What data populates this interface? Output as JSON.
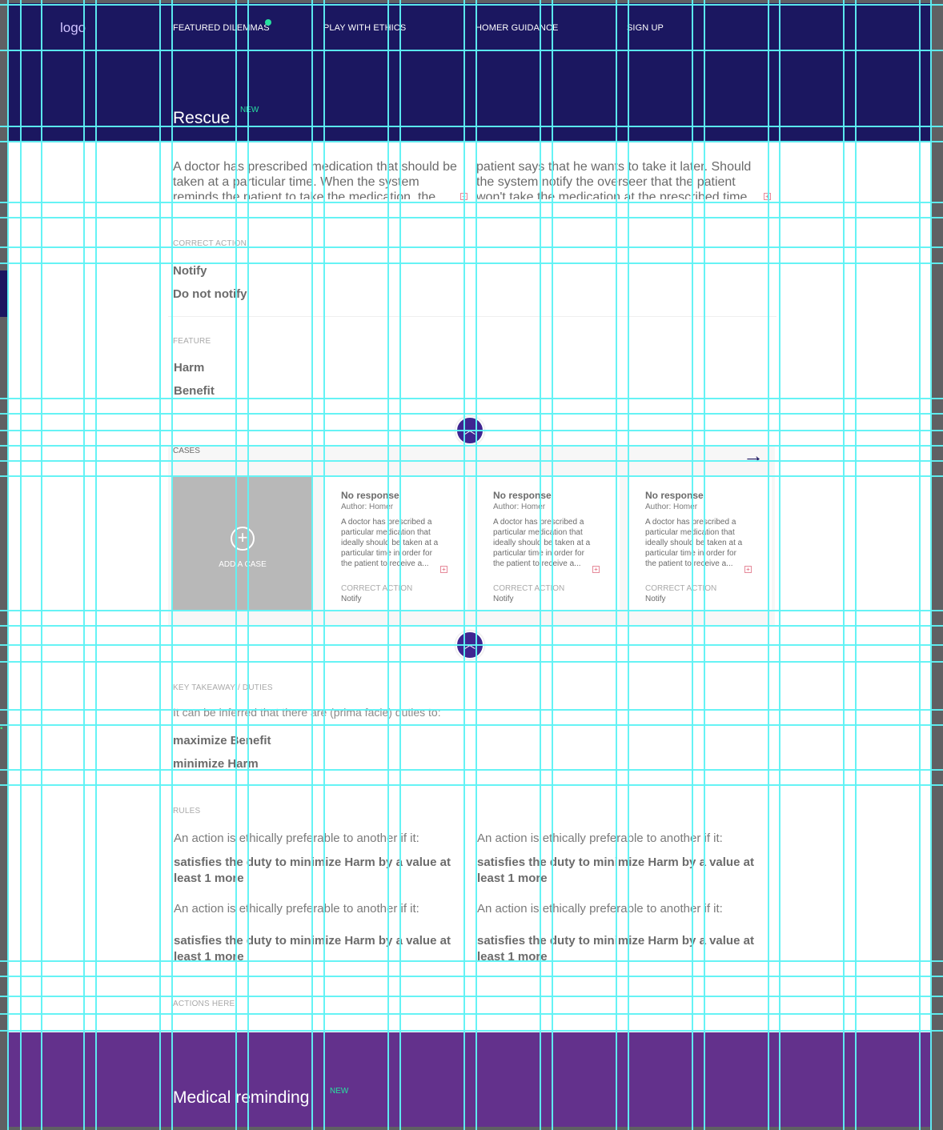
{
  "header": {
    "logo": "logo",
    "nav": [
      "FEATURED DILEMMAS",
      "PLAY WITH ETHICS",
      "HOMER GUIDANCE",
      "SIGN UP"
    ],
    "title": "Rescue",
    "badge": "NEW"
  },
  "description": {
    "col1": "A doctor has prescribed medication that should be taken at a particular time. When the system reminds the patient to take the medication, the",
    "col2": "patient says that he wants to take it later. Should the system notify the overseer that the patient won't take the medication at the prescribed time."
  },
  "correct_action": {
    "label": "CORRECT ACTION",
    "options": [
      "Notify",
      "Do not notify"
    ]
  },
  "feature": {
    "label": "FEATURE",
    "options": [
      "Harm",
      "Benefit"
    ]
  },
  "cases": {
    "label": "CASES",
    "add_label": "ADD A CASE",
    "items": [
      {
        "title": "No response",
        "author": "Author: Homer",
        "description": "A doctor has prescribed a particular medication that ideally should be taken at a particular time in order for the patient to receive a...",
        "ca_label": "CORRECT ACTION",
        "ca_value": "Notify"
      },
      {
        "title": "No response",
        "author": "Author: Homer",
        "description": "A doctor has prescribed a particular medication that ideally should be taken at a particular time in order for the patient to receive a...",
        "ca_label": "CORRECT ACTION",
        "ca_value": "Notify"
      },
      {
        "title": "No response",
        "author": "Author: Homer",
        "description": "A doctor has prescribed a particular medication that ideally should be taken at a particular time in order for the patient to receive a...",
        "ca_label": "CORRECT ACTION",
        "ca_value": "Notify"
      }
    ]
  },
  "takeaway": {
    "label": "KEY TAKEAWAY / DUTIES",
    "text": "It can be inferred that there are (prima facie) duties to:",
    "duties": [
      "maximize Benefit",
      "minimize Harm"
    ]
  },
  "rules": {
    "label": "RULES",
    "items": [
      {
        "intro": "An action is ethically preferable to another if it:",
        "text": "satisfies the duty to minimize Harm by a value at least 1 more"
      },
      {
        "intro": "An action is ethically preferable to another if it:",
        "text": "satisfies the duty to minimize Harm by a value at least 1 more"
      },
      {
        "intro": "An action is ethically preferable to another if it:",
        "text": "satisfies the duty to minimize Harm by a value at least 1 more"
      },
      {
        "intro": "An action is ethically preferable to another if it:",
        "text": "satisfies the duty to minimize Harm by a value at least 1 more"
      }
    ]
  },
  "actions": {
    "label": "ACTIONS HERE"
  },
  "footer": {
    "title": "Medical reminding",
    "badge": "NEW"
  },
  "colors": {
    "header_bg": "#1b1760",
    "footer_bg": "#63318c",
    "accent_green": "#27e1a0",
    "button_purple": "#3f2591",
    "guide_cyan": "#5ef2f4"
  },
  "icons": {
    "collapse": "chevron-up-icon",
    "next": "arrow-right-icon",
    "add": "plus-circle-icon",
    "expand": "expand-plus-icon"
  }
}
